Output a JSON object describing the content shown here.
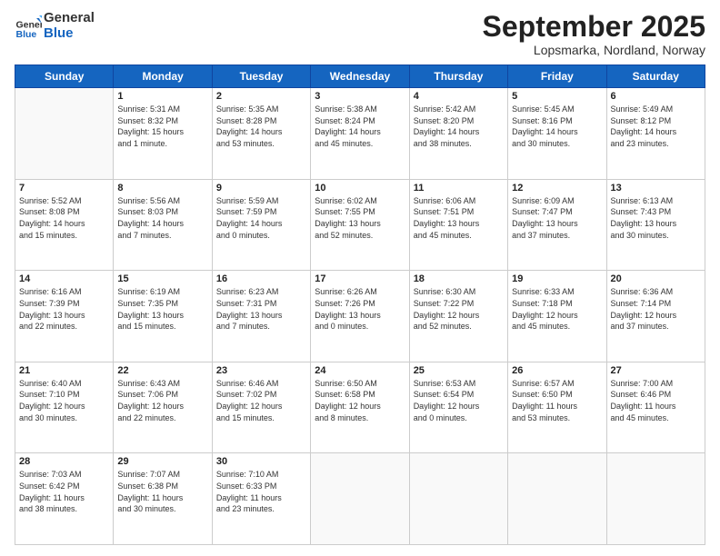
{
  "logo": {
    "line1": "General",
    "line2": "Blue"
  },
  "header": {
    "title": "September 2025",
    "location": "Lopsmarka, Nordland, Norway"
  },
  "weekdays": [
    "Sunday",
    "Monday",
    "Tuesday",
    "Wednesday",
    "Thursday",
    "Friday",
    "Saturday"
  ],
  "weeks": [
    [
      {
        "day": "",
        "info": ""
      },
      {
        "day": "1",
        "info": "Sunrise: 5:31 AM\nSunset: 8:32 PM\nDaylight: 15 hours\nand 1 minute."
      },
      {
        "day": "2",
        "info": "Sunrise: 5:35 AM\nSunset: 8:28 PM\nDaylight: 14 hours\nand 53 minutes."
      },
      {
        "day": "3",
        "info": "Sunrise: 5:38 AM\nSunset: 8:24 PM\nDaylight: 14 hours\nand 45 minutes."
      },
      {
        "day": "4",
        "info": "Sunrise: 5:42 AM\nSunset: 8:20 PM\nDaylight: 14 hours\nand 38 minutes."
      },
      {
        "day": "5",
        "info": "Sunrise: 5:45 AM\nSunset: 8:16 PM\nDaylight: 14 hours\nand 30 minutes."
      },
      {
        "day": "6",
        "info": "Sunrise: 5:49 AM\nSunset: 8:12 PM\nDaylight: 14 hours\nand 23 minutes."
      }
    ],
    [
      {
        "day": "7",
        "info": "Sunrise: 5:52 AM\nSunset: 8:08 PM\nDaylight: 14 hours\nand 15 minutes."
      },
      {
        "day": "8",
        "info": "Sunrise: 5:56 AM\nSunset: 8:03 PM\nDaylight: 14 hours\nand 7 minutes."
      },
      {
        "day": "9",
        "info": "Sunrise: 5:59 AM\nSunset: 7:59 PM\nDaylight: 14 hours\nand 0 minutes."
      },
      {
        "day": "10",
        "info": "Sunrise: 6:02 AM\nSunset: 7:55 PM\nDaylight: 13 hours\nand 52 minutes."
      },
      {
        "day": "11",
        "info": "Sunrise: 6:06 AM\nSunset: 7:51 PM\nDaylight: 13 hours\nand 45 minutes."
      },
      {
        "day": "12",
        "info": "Sunrise: 6:09 AM\nSunset: 7:47 PM\nDaylight: 13 hours\nand 37 minutes."
      },
      {
        "day": "13",
        "info": "Sunrise: 6:13 AM\nSunset: 7:43 PM\nDaylight: 13 hours\nand 30 minutes."
      }
    ],
    [
      {
        "day": "14",
        "info": "Sunrise: 6:16 AM\nSunset: 7:39 PM\nDaylight: 13 hours\nand 22 minutes."
      },
      {
        "day": "15",
        "info": "Sunrise: 6:19 AM\nSunset: 7:35 PM\nDaylight: 13 hours\nand 15 minutes."
      },
      {
        "day": "16",
        "info": "Sunrise: 6:23 AM\nSunset: 7:31 PM\nDaylight: 13 hours\nand 7 minutes."
      },
      {
        "day": "17",
        "info": "Sunrise: 6:26 AM\nSunset: 7:26 PM\nDaylight: 13 hours\nand 0 minutes."
      },
      {
        "day": "18",
        "info": "Sunrise: 6:30 AM\nSunset: 7:22 PM\nDaylight: 12 hours\nand 52 minutes."
      },
      {
        "day": "19",
        "info": "Sunrise: 6:33 AM\nSunset: 7:18 PM\nDaylight: 12 hours\nand 45 minutes."
      },
      {
        "day": "20",
        "info": "Sunrise: 6:36 AM\nSunset: 7:14 PM\nDaylight: 12 hours\nand 37 minutes."
      }
    ],
    [
      {
        "day": "21",
        "info": "Sunrise: 6:40 AM\nSunset: 7:10 PM\nDaylight: 12 hours\nand 30 minutes."
      },
      {
        "day": "22",
        "info": "Sunrise: 6:43 AM\nSunset: 7:06 PM\nDaylight: 12 hours\nand 22 minutes."
      },
      {
        "day": "23",
        "info": "Sunrise: 6:46 AM\nSunset: 7:02 PM\nDaylight: 12 hours\nand 15 minutes."
      },
      {
        "day": "24",
        "info": "Sunrise: 6:50 AM\nSunset: 6:58 PM\nDaylight: 12 hours\nand 8 minutes."
      },
      {
        "day": "25",
        "info": "Sunrise: 6:53 AM\nSunset: 6:54 PM\nDaylight: 12 hours\nand 0 minutes."
      },
      {
        "day": "26",
        "info": "Sunrise: 6:57 AM\nSunset: 6:50 PM\nDaylight: 11 hours\nand 53 minutes."
      },
      {
        "day": "27",
        "info": "Sunrise: 7:00 AM\nSunset: 6:46 PM\nDaylight: 11 hours\nand 45 minutes."
      }
    ],
    [
      {
        "day": "28",
        "info": "Sunrise: 7:03 AM\nSunset: 6:42 PM\nDaylight: 11 hours\nand 38 minutes."
      },
      {
        "day": "29",
        "info": "Sunrise: 7:07 AM\nSunset: 6:38 PM\nDaylight: 11 hours\nand 30 minutes."
      },
      {
        "day": "30",
        "info": "Sunrise: 7:10 AM\nSunset: 6:33 PM\nDaylight: 11 hours\nand 23 minutes."
      },
      {
        "day": "",
        "info": ""
      },
      {
        "day": "",
        "info": ""
      },
      {
        "day": "",
        "info": ""
      },
      {
        "day": "",
        "info": ""
      }
    ]
  ]
}
